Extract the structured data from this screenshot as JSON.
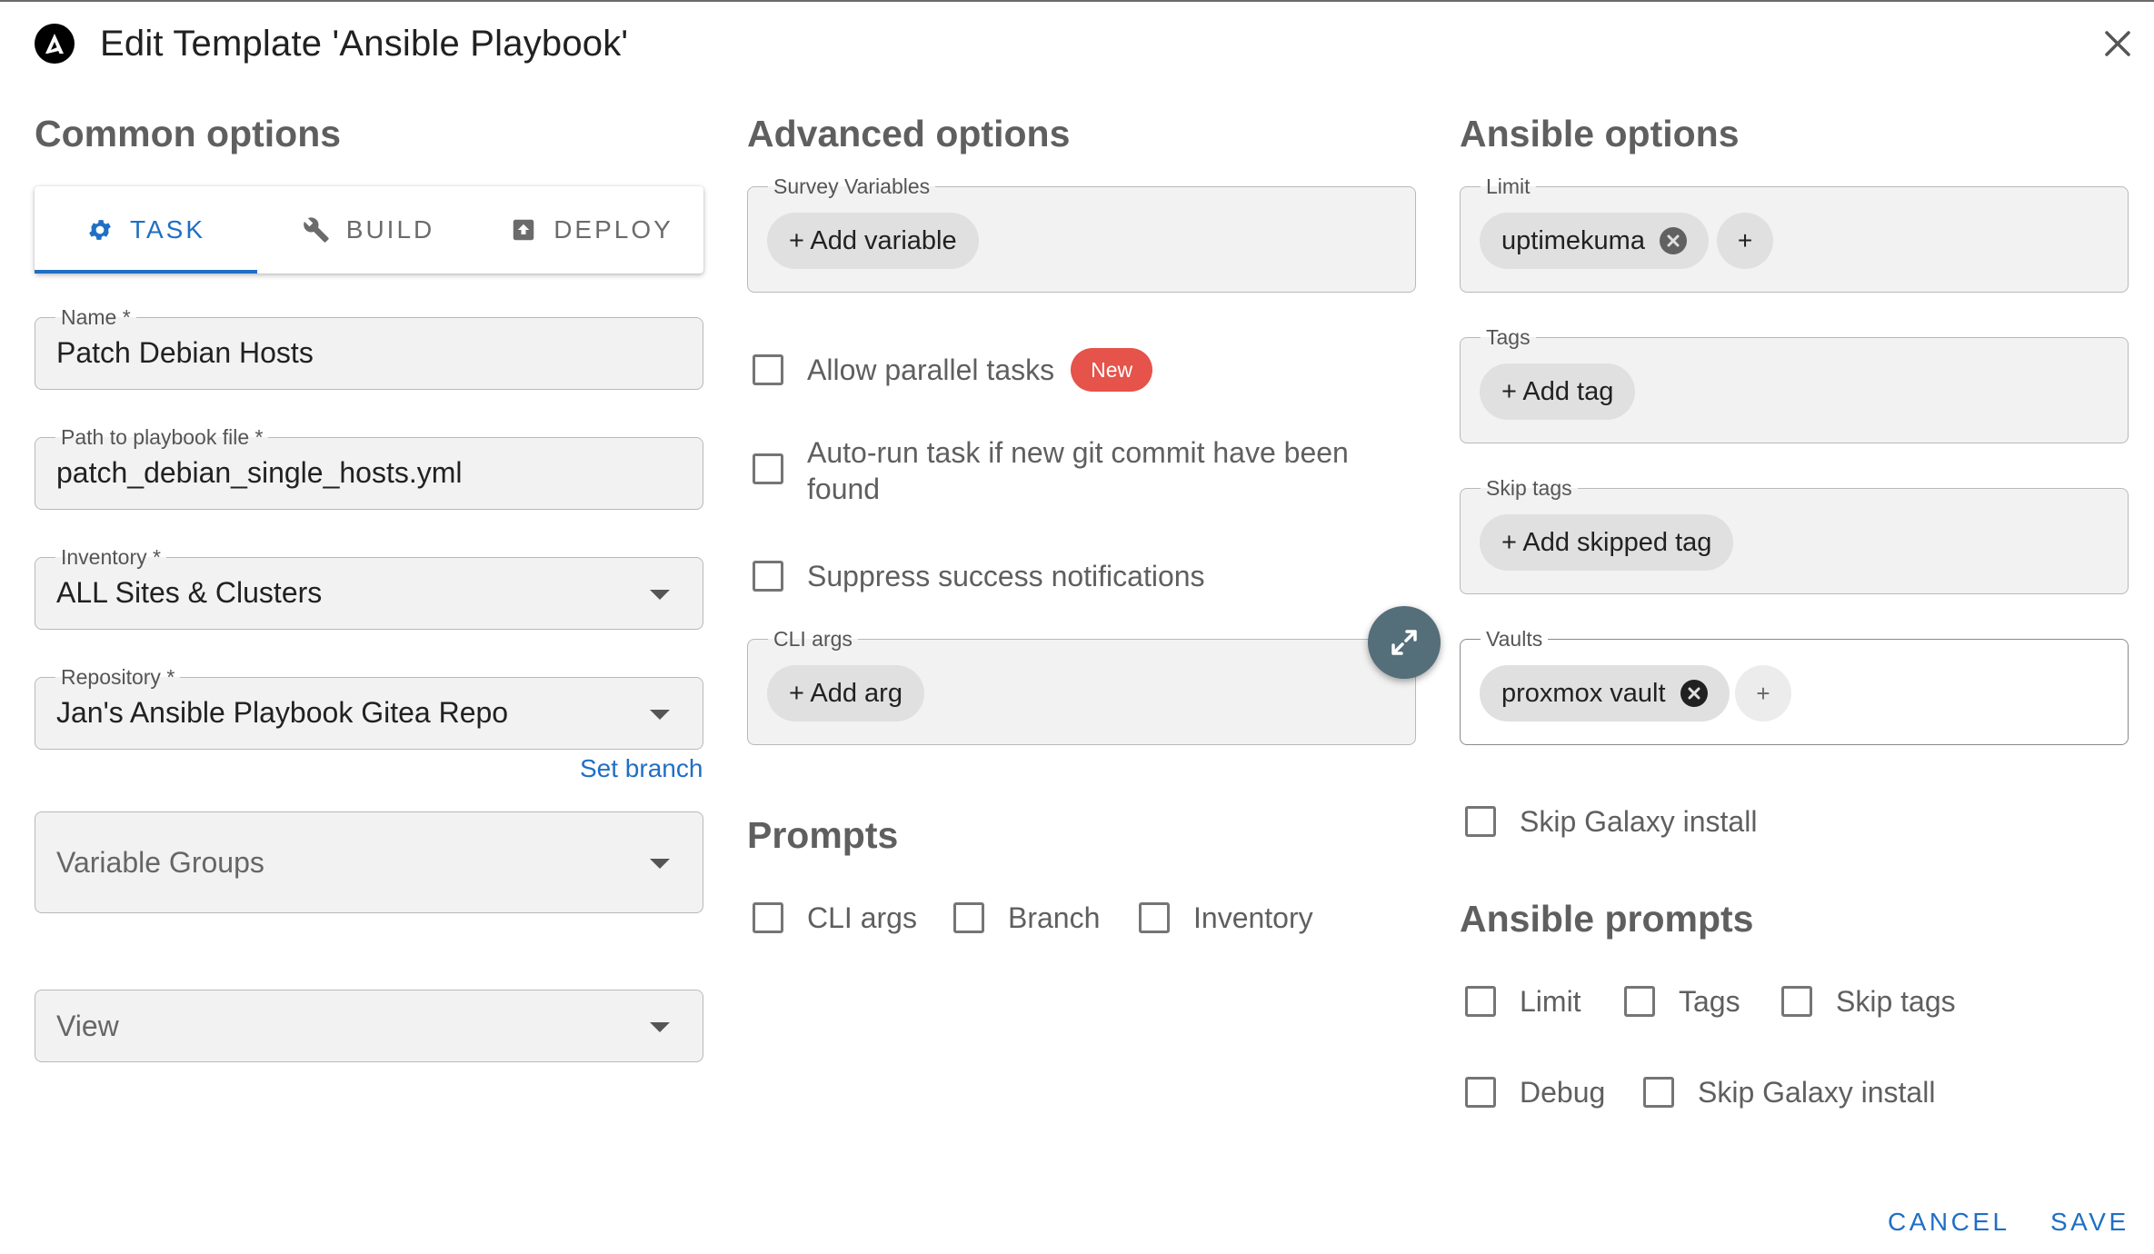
{
  "dialog": {
    "title": "Edit Template 'Ansible Playbook'",
    "logo_icon": "ansible-logo",
    "close_icon": "close-icon"
  },
  "common": {
    "heading": "Common options",
    "tabs": [
      {
        "label": "TASK",
        "icon": "gear-icon",
        "active": true
      },
      {
        "label": "BUILD",
        "icon": "wrench-icon",
        "active": false
      },
      {
        "label": "DEPLOY",
        "icon": "upload-box-icon",
        "active": false
      }
    ],
    "name": {
      "label": "Name *",
      "value": "Patch Debian Hosts"
    },
    "playbook": {
      "label": "Path to playbook file *",
      "value": "patch_debian_single_hosts.yml"
    },
    "inventory": {
      "label": "Inventory *",
      "value": "ALL Sites & Clusters"
    },
    "repository": {
      "label": "Repository *",
      "value": "Jan's Ansible Playbook Gitea Repo"
    },
    "set_branch": "Set branch",
    "variable_groups": {
      "placeholder": "Variable Groups"
    },
    "view": {
      "placeholder": "View"
    }
  },
  "advanced": {
    "heading": "Advanced options",
    "survey": {
      "label": "Survey Variables",
      "add": "+ Add variable"
    },
    "allow_parallel": {
      "label": "Allow parallel tasks",
      "badge": "New",
      "checked": false
    },
    "autorun": {
      "label_line1": "Auto-run task if new git commit have been",
      "label_line2": "found",
      "checked": false
    },
    "suppress": {
      "label": "Suppress success notifications",
      "checked": false
    },
    "cli_args": {
      "label": "CLI args",
      "add": "+ Add arg"
    },
    "prompts_heading": "Prompts",
    "prompts": [
      {
        "label": "CLI args",
        "checked": false
      },
      {
        "label": "Branch",
        "checked": false
      },
      {
        "label": "Inventory",
        "checked": false
      }
    ]
  },
  "ansible": {
    "heading": "Ansible options",
    "limit": {
      "label": "Limit",
      "chip": "uptimekuma",
      "add": "+"
    },
    "tags": {
      "label": "Tags",
      "add": "+ Add tag"
    },
    "skip_tags": {
      "label": "Skip tags",
      "add": "+ Add skipped tag"
    },
    "vaults": {
      "label": "Vaults",
      "chip": "proxmox vault",
      "add": "+"
    },
    "skip_galaxy": {
      "label": "Skip Galaxy install",
      "checked": false
    },
    "prompts_heading": "Ansible prompts",
    "prompts_row1": [
      {
        "label": "Limit",
        "checked": false
      },
      {
        "label": "Tags",
        "checked": false
      },
      {
        "label": "Skip tags",
        "checked": false
      }
    ],
    "prompts_row2": [
      {
        "label": "Debug",
        "checked": false
      },
      {
        "label": "Skip Galaxy install",
        "checked": false
      }
    ]
  },
  "actions": {
    "cancel": "CANCEL",
    "save": "SAVE"
  },
  "colors": {
    "accent": "#1f6fc5",
    "badge": "#e5534b",
    "fab": "#546e7a"
  }
}
